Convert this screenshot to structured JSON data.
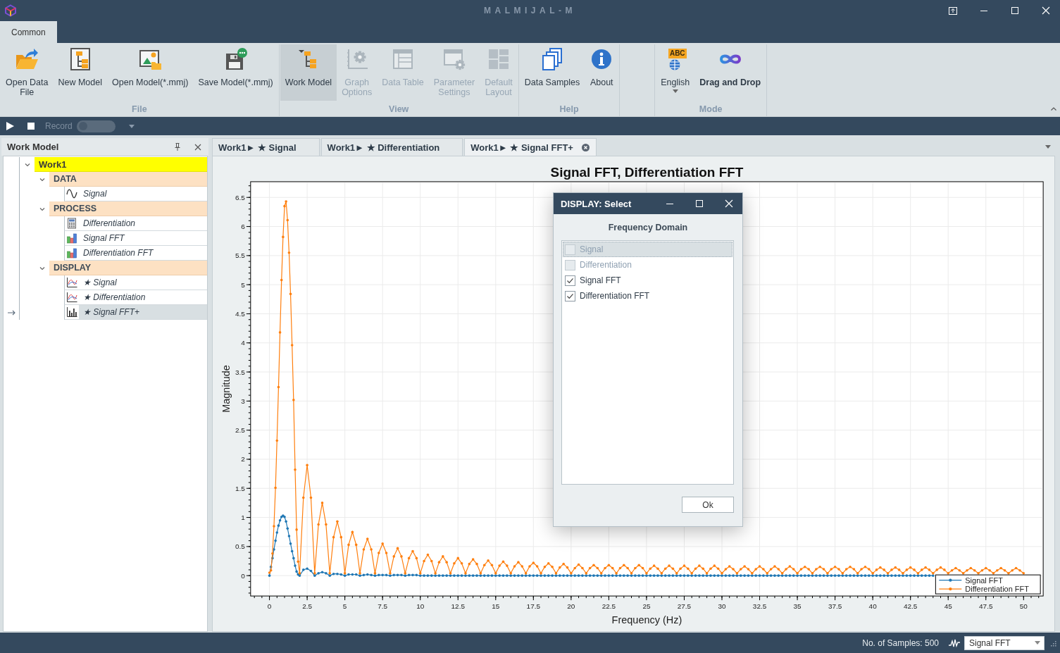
{
  "window": {
    "title": "MALMIJAL-M"
  },
  "ribbon": {
    "tabs": [
      {
        "label": "Common",
        "selected": true
      }
    ],
    "groups": [
      {
        "label": "File",
        "items": [
          {
            "lines": [
              "Open Data",
              "File"
            ],
            "kind": "button",
            "disabled": false,
            "pressed": false,
            "active": false
          },
          {
            "lines": [
              "New Model"
            ],
            "kind": "button",
            "disabled": false,
            "pressed": false,
            "active": false
          },
          {
            "lines": [
              "Open Model(*.mmj)"
            ],
            "kind": "button",
            "disabled": false,
            "pressed": false,
            "active": false
          },
          {
            "lines": [
              "Save Model(*.mmj)"
            ],
            "kind": "button",
            "disabled": false,
            "pressed": false,
            "active": false
          }
        ]
      },
      {
        "label": "View",
        "items": [
          {
            "lines": [
              "Work Model"
            ],
            "kind": "button",
            "disabled": false,
            "pressed": true,
            "active": false
          },
          {
            "lines": [
              "Graph",
              "Options"
            ],
            "kind": "button",
            "disabled": true,
            "pressed": false,
            "active": false
          },
          {
            "lines": [
              "Data Table"
            ],
            "kind": "button",
            "disabled": true,
            "pressed": false,
            "active": false
          },
          {
            "lines": [
              "Parameter",
              "Settings"
            ],
            "kind": "button",
            "disabled": true,
            "pressed": false,
            "active": false
          },
          {
            "lines": [
              "Default",
              "Layout"
            ],
            "kind": "button",
            "disabled": true,
            "pressed": false,
            "active": false
          }
        ]
      },
      {
        "label": "Help",
        "items": [
          {
            "lines": [
              "Data Samples"
            ],
            "kind": "button",
            "disabled": false,
            "pressed": false,
            "active": false
          },
          {
            "lines": [
              "About"
            ],
            "kind": "button",
            "disabled": false,
            "pressed": false,
            "active": false
          }
        ]
      },
      {
        "label": "Mode",
        "items": [
          {
            "lines": [
              "English"
            ],
            "badge": "ABC",
            "kind": "dropdown",
            "disabled": false,
            "pressed": false,
            "active": false
          },
          {
            "lines": [
              "Drag and Drop"
            ],
            "kind": "button",
            "disabled": false,
            "pressed": false,
            "active": true
          }
        ]
      }
    ]
  },
  "toolbar": {
    "record": {
      "label": "Record",
      "on": false,
      "disabled": true
    }
  },
  "panel": {
    "title": "Work Model",
    "tree": [
      {
        "label": "Work1",
        "kind": "model",
        "selected": false,
        "expanded": true,
        "children": [
          {
            "label": "DATA",
            "kind": "group",
            "selected": false,
            "expanded": true,
            "children": [
              {
                "label": "Signal",
                "kind": "data",
                "selected": false
              }
            ]
          },
          {
            "label": "PROCESS",
            "kind": "group",
            "selected": false,
            "expanded": true,
            "children": [
              {
                "label": "Differentiation",
                "kind": "process",
                "selected": false
              },
              {
                "label": "Signal FFT",
                "kind": "fft",
                "selected": false
              },
              {
                "label": "Differentiation FFT",
                "kind": "fft",
                "selected": false
              }
            ]
          },
          {
            "label": "DISPLAY",
            "kind": "group",
            "selected": false,
            "expanded": true,
            "children": [
              {
                "label": "★ Signal",
                "kind": "plot",
                "selected": false
              },
              {
                "label": "★ Differentiation",
                "kind": "plot",
                "selected": false
              },
              {
                "label": "★ Signal FFT+",
                "kind": "spectrum",
                "selected": true
              }
            ]
          }
        ]
      }
    ]
  },
  "doc_tabs": [
    {
      "label": "Work1► ★ Signal",
      "selected": false
    },
    {
      "label": "Work1► ★ Differentiation",
      "selected": false
    },
    {
      "label": "Work1► ★ Signal FFT+",
      "selected": true
    }
  ],
  "chart": {
    "chart_data": {
      "type": "line",
      "title": "Signal FFT, Differentiation FFT",
      "xlabel": "Frequency (Hz)",
      "ylabel": "Magnitude",
      "x": [
        0,
        0.1,
        0.2,
        0.3,
        0.4,
        0.5,
        0.6,
        0.7,
        0.8,
        0.9,
        1,
        1.1,
        1.2,
        1.3,
        1.4,
        1.5,
        1.6,
        1.7,
        1.8,
        1.9,
        2,
        2.25,
        2.5,
        2.75,
        3,
        3.25,
        3.5,
        3.75,
        4,
        4.25,
        4.5,
        4.75,
        5,
        5.25,
        5.5,
        5.75,
        6,
        6.25,
        6.5,
        6.75,
        7,
        7.25,
        7.5,
        7.75,
        8,
        8.25,
        8.5,
        8.75,
        9,
        9.25,
        9.5,
        9.75,
        10,
        10.25,
        10.5,
        10.75,
        11,
        11.25,
        11.5,
        11.75,
        12,
        12.25,
        12.5,
        12.75,
        13,
        13.25,
        13.5,
        13.75,
        14,
        14.25,
        14.5,
        14.75,
        15,
        15.25,
        15.5,
        15.75,
        16,
        16.25,
        16.5,
        16.75,
        17,
        17.25,
        17.5,
        17.75,
        18,
        18.25,
        18.5,
        18.75,
        19,
        19.25,
        19.5,
        19.75,
        20,
        20.25,
        20.5,
        20.75,
        21,
        21.25,
        21.5,
        21.75,
        22,
        22.25,
        22.5,
        22.75,
        23,
        23.25,
        23.5,
        23.75,
        24,
        24.25,
        24.5,
        24.75,
        25,
        25.25,
        25.5,
        25.75,
        26,
        26.25,
        26.5,
        26.75,
        27,
        27.25,
        27.5,
        27.75,
        28,
        28.25,
        28.5,
        28.75,
        29,
        29.25,
        29.5,
        29.75,
        30,
        30.25,
        30.5,
        30.75,
        31,
        31.25,
        31.5,
        31.75,
        32,
        32.25,
        32.5,
        32.75,
        33,
        33.25,
        33.5,
        33.75,
        34,
        34.25,
        34.5,
        34.75,
        35,
        35.25,
        35.5,
        35.75,
        36,
        36.25,
        36.5,
        36.75,
        37,
        37.25,
        37.5,
        37.75,
        38,
        38.25,
        38.5,
        38.75,
        39,
        39.25,
        39.5,
        39.75,
        40,
        40.25,
        40.5,
        40.75,
        41,
        41.25,
        41.5,
        41.75,
        42,
        42.25,
        42.5,
        42.75,
        43,
        43.25,
        43.5,
        43.75,
        44,
        44.25,
        44.5,
        44.75,
        45,
        45.25,
        45.5,
        45.75,
        46,
        46.25,
        46.5,
        46.75,
        47,
        47.25,
        47.5,
        47.75,
        48,
        48.25,
        48.5,
        48.75,
        49,
        49.25,
        49.5,
        49.75,
        50
      ],
      "series": [
        {
          "name": "Signal FFT",
          "color": "#1f77b4",
          "values": [
            0,
            0.15,
            0.3,
            0.45,
            0.6,
            0.74,
            0.86,
            0.95,
            1.01,
            1.03,
            1.01,
            0.93,
            0.81,
            0.68,
            0.55,
            0.42,
            0.3,
            0.17,
            0.07,
            0.02,
            0,
            0.1,
            0.12,
            0.08,
            0,
            0.04,
            0.06,
            0.04,
            0,
            0.03,
            0.03,
            0.02,
            0,
            0.02,
            0.02,
            0.02,
            0,
            0.01,
            0.02,
            0.01,
            0,
            0.01,
            0.01,
            0.01,
            0,
            0.01,
            0.01,
            0.01,
            0,
            0.01,
            0.01,
            0.01,
            0,
            0,
            0,
            0,
            0,
            0,
            0,
            0,
            0,
            0,
            0,
            0,
            0,
            0,
            0,
            0,
            0,
            0,
            0,
            0,
            0,
            0,
            0,
            0,
            0,
            0,
            0,
            0,
            0,
            0,
            0,
            0,
            0,
            0,
            0,
            0,
            0,
            0,
            0,
            0,
            0,
            0,
            0,
            0,
            0,
            0,
            0,
            0,
            0,
            0,
            0,
            0,
            0,
            0,
            0,
            0,
            0,
            0,
            0,
            0,
            0,
            0,
            0,
            0,
            0,
            0,
            0,
            0,
            0,
            0,
            0,
            0,
            0,
            0,
            0,
            0,
            0,
            0,
            0,
            0,
            0,
            0,
            0,
            0,
            0,
            0,
            0,
            0,
            0,
            0,
            0,
            0,
            0,
            0,
            0,
            0,
            0,
            0,
            0,
            0,
            0,
            0,
            0,
            0,
            0,
            0,
            0,
            0,
            0,
            0,
            0,
            0,
            0,
            0,
            0,
            0,
            0,
            0,
            0,
            0,
            0,
            0,
            0,
            0,
            0,
            0,
            0,
            0,
            0,
            0,
            0,
            0,
            0,
            0,
            0,
            0,
            0,
            null,
            null,
            null,
            null,
            null,
            null,
            null,
            null,
            null,
            null,
            null,
            null,
            null,
            null,
            null,
            null,
            null,
            null,
            null,
            null,
            null,
            null,
            null,
            null
          ]
        },
        {
          "name": "Differentiation FFT",
          "color": "#ff7f0e",
          "values": [
            0.05,
            0.09,
            0.38,
            0.85,
            1.51,
            2.32,
            3.24,
            4.18,
            5.08,
            5.82,
            6.35,
            6.43,
            6.11,
            5.55,
            4.84,
            3.96,
            3.02,
            1.82,
            0.79,
            0.24,
            0.04,
            1.34,
            1.9,
            1.34,
            0.04,
            0.88,
            1.25,
            0.88,
            0.04,
            0.66,
            0.93,
            0.66,
            0.04,
            0.53,
            0.75,
            0.53,
            0.04,
            0.45,
            0.63,
            0.45,
            0.04,
            0.39,
            0.55,
            0.39,
            0.04,
            0.33,
            0.47,
            0.33,
            0.04,
            0.3,
            0.42,
            0.3,
            0.04,
            0.25,
            0.36,
            0.25,
            0.04,
            0.23,
            0.33,
            0.23,
            0.04,
            0.21,
            0.3,
            0.21,
            0.04,
            0.2,
            0.28,
            0.2,
            0.04,
            0.18,
            0.26,
            0.18,
            0.04,
            0.17,
            0.24,
            0.17,
            0.04,
            0.16,
            0.23,
            0.16,
            0.04,
            0.16,
            0.22,
            0.16,
            0.04,
            0.15,
            0.21,
            0.15,
            0.04,
            0.14,
            0.2,
            0.14,
            0.04,
            0.13,
            0.19,
            0.13,
            0.04,
            0.13,
            0.18,
            0.13,
            0.04,
            0.13,
            0.18,
            0.13,
            0.04,
            0.13,
            0.18,
            0.13,
            0.04,
            0.13,
            0.18,
            0.13,
            0.04,
            0.12,
            0.17,
            0.12,
            0.04,
            0.12,
            0.17,
            0.12,
            0.04,
            0.12,
            0.17,
            0.12,
            0.04,
            0.12,
            0.17,
            0.12,
            0.04,
            0.12,
            0.17,
            0.12,
            0.04,
            0.11,
            0.16,
            0.11,
            0.04,
            0.11,
            0.16,
            0.11,
            0.04,
            0.11,
            0.16,
            0.11,
            0.04,
            0.11,
            0.16,
            0.11,
            0.04,
            0.11,
            0.16,
            0.11,
            0.04,
            0.11,
            0.15,
            0.11,
            0.04,
            0.11,
            0.15,
            0.11,
            0.04,
            0.11,
            0.15,
            0.11,
            0.04,
            0.11,
            0.15,
            0.11,
            0.04,
            0.11,
            0.15,
            0.11,
            0.04,
            0.1,
            0.14,
            0.1,
            0.04,
            0.1,
            0.14,
            0.1,
            0.04,
            0.1,
            0.14,
            0.1,
            0.04,
            0.1,
            0.14,
            0.1,
            0.04,
            0.1,
            0.14,
            0.1,
            0.04,
            0.09,
            0.13,
            0.09,
            0.04,
            0.09,
            0.13,
            0.09,
            0.04,
            0.09,
            0.13,
            0.09,
            0.04,
            0.09,
            0.13,
            0.09,
            0.04,
            0.09,
            0.13,
            0.09,
            0.04
          ]
        }
      ],
      "xlim": [
        -1.25,
        51.3
      ],
      "ylim": [
        -0.35,
        6.77
      ],
      "xticks": [
        0,
        2.5,
        5,
        7.5,
        10,
        12.5,
        15,
        17.5,
        20,
        22.5,
        25,
        27.5,
        30,
        32.5,
        35,
        37.5,
        40,
        42.5,
        45,
        47.5,
        50
      ],
      "yticks": [
        0,
        0.5,
        1,
        1.5,
        2,
        2.5,
        3,
        3.5,
        4,
        4.5,
        5,
        5.5,
        6,
        6.5
      ],
      "grid": true,
      "legend": true
    }
  },
  "dialog": {
    "title": "DISPLAY: Select",
    "heading": "Frequency Domain",
    "options": [
      {
        "label": "Signal",
        "checked": false,
        "disabled": true,
        "selected": true
      },
      {
        "label": "Differentiation",
        "checked": false,
        "disabled": true,
        "selected": false
      },
      {
        "label": "Signal FFT",
        "checked": true,
        "disabled": false,
        "selected": false
      },
      {
        "label": "Differentiation FFT",
        "checked": true,
        "disabled": false,
        "selected": false
      }
    ],
    "ok_button": "Ok"
  },
  "status_bar": {
    "samples": "No. of Samples: 500",
    "series_select": "Signal FFT"
  }
}
